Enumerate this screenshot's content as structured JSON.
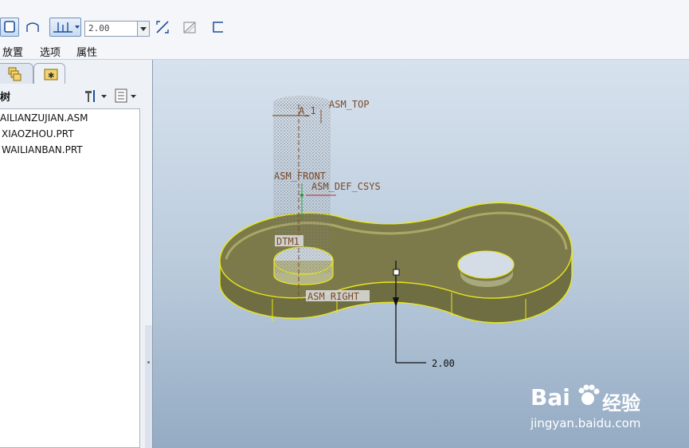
{
  "toolbar": {
    "offset_value": "2.00",
    "tabs": [
      "放置",
      "选项",
      "属性"
    ]
  },
  "left_panel": {
    "header_title": "树",
    "tree_items": [
      "AILIANZUJIAN.ASM",
      "XIAOZHOU.PRT",
      "WAILIANBAN.PRT"
    ]
  },
  "viewport": {
    "datum_labels": {
      "axis": "A_1",
      "top": "ASM_TOP",
      "front": "ASM_FRONT",
      "csys": "ASM_DEF_CSYS",
      "dtm": "DTM1",
      "right": "ASM_RIGHT"
    },
    "dimension_value": "2.00"
  },
  "watermark": {
    "brand": "Bai",
    "brand_tail": "经验",
    "url": "jingyan.baidu.com"
  },
  "colors": {
    "model_fill": "#7c7a4a",
    "model_edge": "#e8e81a",
    "view_bg_top": "#d7e2ee",
    "view_bg_bottom": "#94abc3"
  }
}
